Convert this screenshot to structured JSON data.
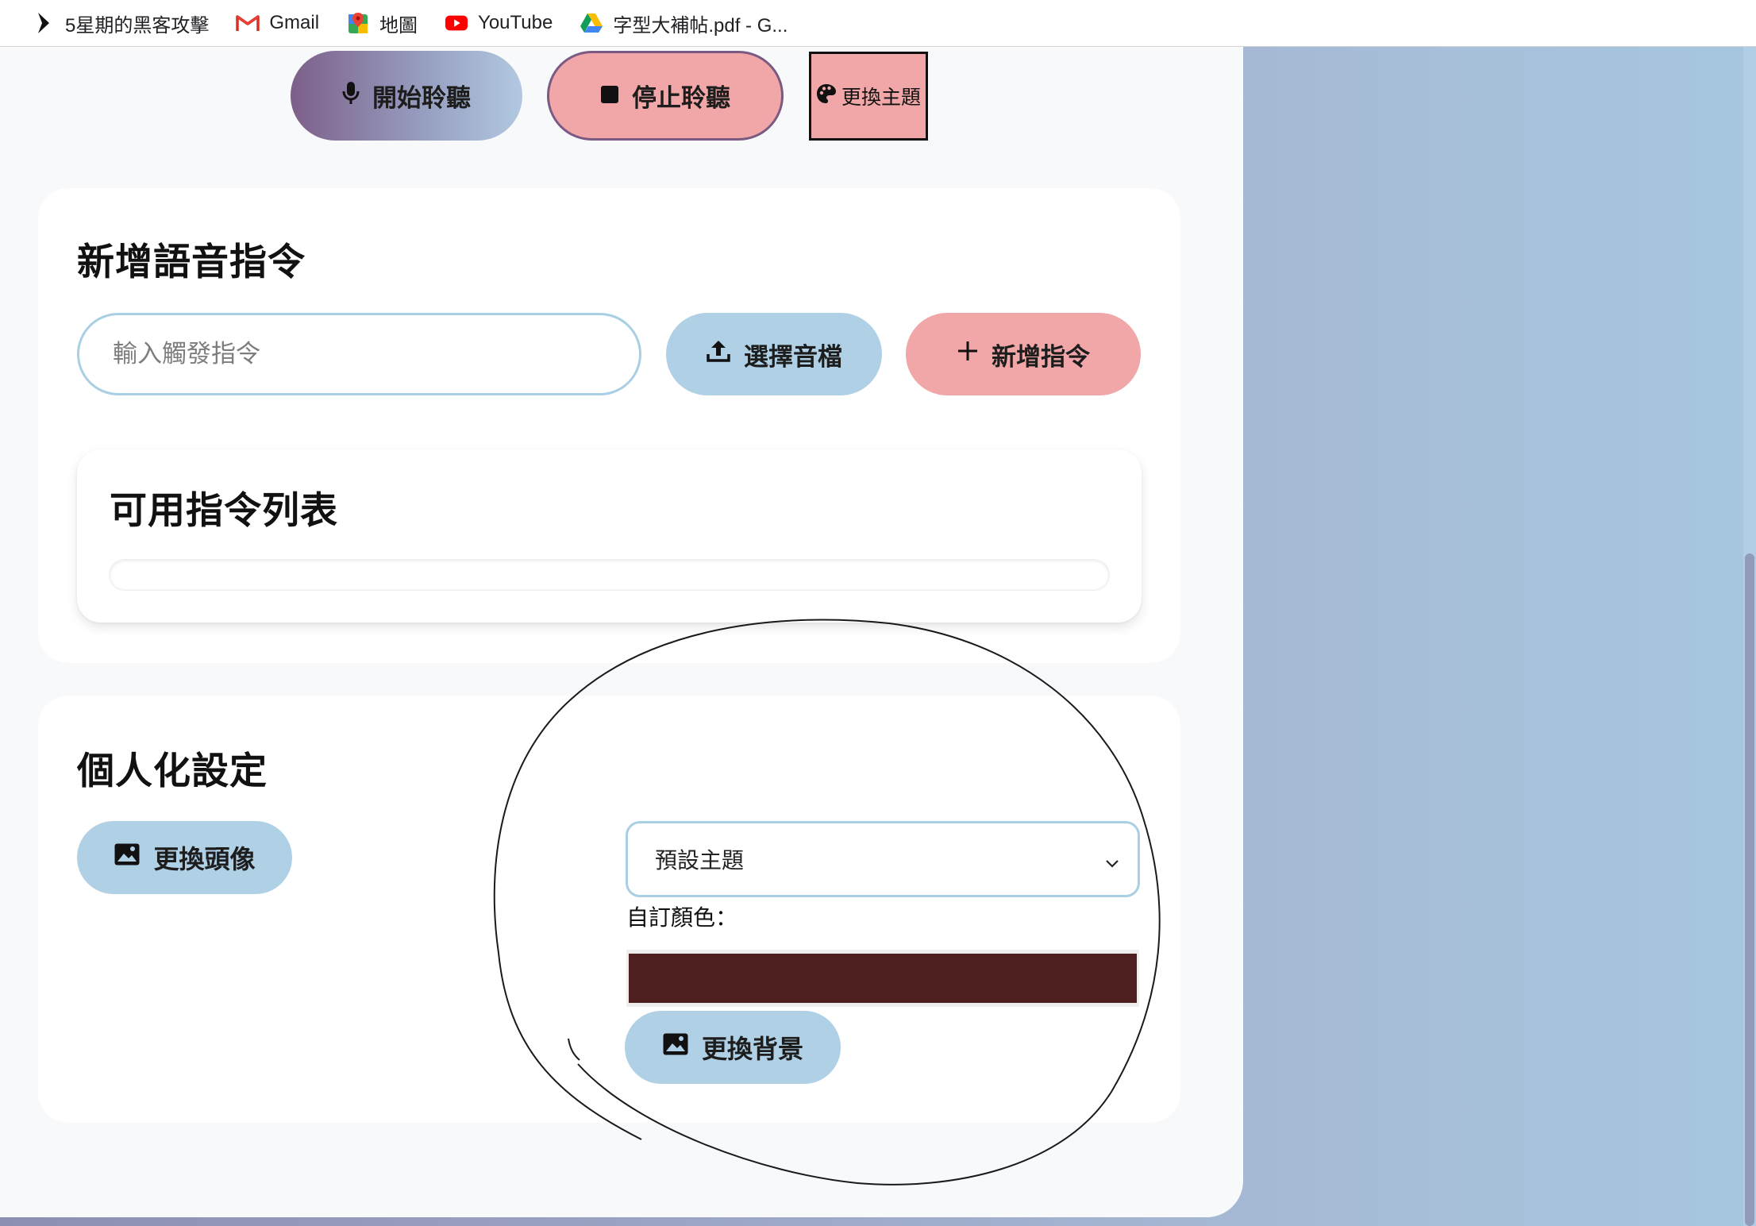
{
  "bookmarks": [
    {
      "label": "5星期的黑客攻擊",
      "icon": "arrow-cursor-icon"
    },
    {
      "label": "Gmail",
      "icon": "gmail-icon"
    },
    {
      "label": "地圖",
      "icon": "maps-icon"
    },
    {
      "label": "YouTube",
      "icon": "youtube-icon"
    },
    {
      "label": "字型大補帖.pdf - G...",
      "icon": "google-drive-icon"
    }
  ],
  "toolbar": {
    "start_label": "開始聆聽",
    "stop_label": "停止聆聽",
    "theme_label": "更換主題"
  },
  "commands": {
    "title": "新增語音指令",
    "trigger_placeholder": "輸入觸發指令",
    "trigger_value": "",
    "upload_label": "選擇音檔",
    "add_label": "新增指令",
    "list_title": "可用指令列表",
    "items": []
  },
  "personal": {
    "title": "個人化設定",
    "avatar_label": "更換頭像",
    "theme_selected": "預設主題",
    "custom_color_label": "自訂顏色：",
    "custom_color_value": "#4f1f20",
    "background_label": "更換背景"
  },
  "colors": {
    "accent_blue": "#b0d0e6",
    "accent_pink": "#f1a6a7",
    "accent_purple": "#7d5f89"
  }
}
